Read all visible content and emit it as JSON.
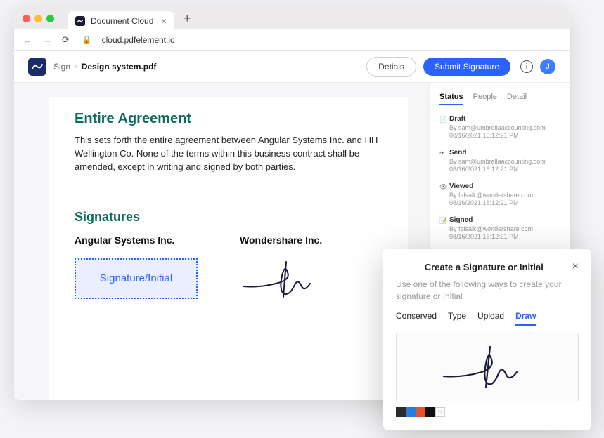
{
  "browser": {
    "tab_title": "Document Cloud",
    "url": "cloud.pdfelement.io"
  },
  "toolbar": {
    "breadcrumb_root": "Sign",
    "breadcrumb_file": "Design system.pdf",
    "details_btn": "Detials",
    "submit_btn": "Submit Signature",
    "avatar_initial": "J"
  },
  "document": {
    "heading1": "Entire Agreement",
    "paragraph": "This sets forth the entire agreement between Angular Systems Inc. and HH Wellington Co. None of the terms within this business contract shall be amended, except in writing and signed by both parties.",
    "heading2": "Signatures",
    "signer1": "Angular Systems Inc.",
    "signer2": "Wondershare Inc.",
    "placeholder_label": "Signature/Initial"
  },
  "sidebar": {
    "tabs": {
      "status": "Status",
      "people": "People",
      "detail": "Detail"
    },
    "events": [
      {
        "title": "Draft",
        "by": "By sam@umbrellaaccounting.com",
        "date": "08/16/2021 16:12:21 PM"
      },
      {
        "title": "Send",
        "by": "By sam@umbrellaaccounting.com",
        "date": "08/16/2021 16:12:21 PM"
      },
      {
        "title": "Viewed",
        "by": "By falsalk@wondershare.com",
        "date": "08/16/2021 18:12:21 PM"
      },
      {
        "title": "Signed",
        "by": "By falsalk@wondershare.com",
        "date": "08/16/2021 16:12:21 PM"
      }
    ]
  },
  "modal": {
    "title": "Create a Signature or Initial",
    "subtitle": "Use one of the following ways to create your signature or Initial",
    "tabs": {
      "conserved": "Conserved",
      "type": "Type",
      "upload": "Upload",
      "draw": "Draw"
    },
    "swatches": [
      "#2b2b2b",
      "#2a7bde",
      "#e6502d",
      "#111111"
    ]
  }
}
